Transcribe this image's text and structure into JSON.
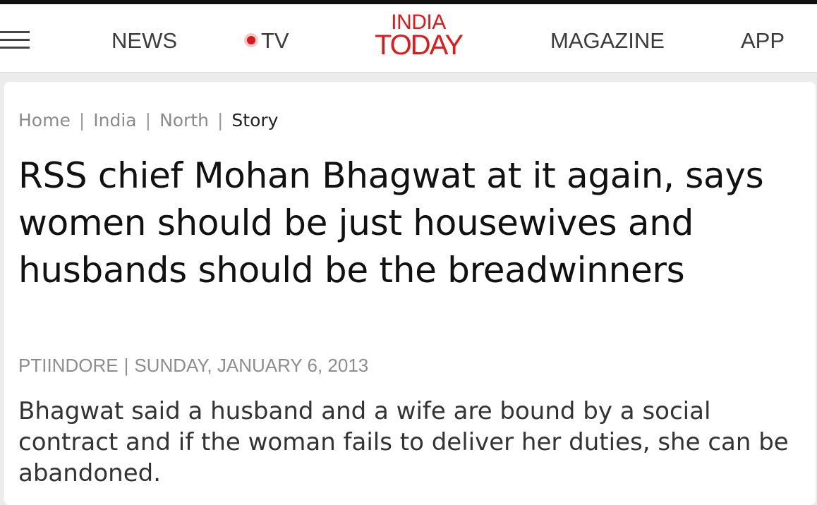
{
  "header": {
    "nav": {
      "news": "NEWS",
      "tv": "TV",
      "magazine": "MAGAZINE",
      "app": "APP"
    },
    "logo": {
      "line1": "INDIA",
      "line2": "TODAY"
    },
    "icons": {
      "menu": "hamburger-menu-icon",
      "live": "live-dot-icon"
    },
    "colors": {
      "brand_red": "#e0191b",
      "live_dot": "#d7191c"
    }
  },
  "breadcrumb": {
    "home": "Home",
    "separator": "|",
    "india": "India",
    "north": "North",
    "current": "Story"
  },
  "article": {
    "headline": "RSS chief Mohan Bhagwat at it again, says women should be just housewives and husbands should be the breadwinners",
    "byline": {
      "source": "PTIINDORE",
      "separator": "|",
      "date": "SUNDAY, JANUARY 6, 2013"
    },
    "summary": "Bhagwat said a husband and a wife are bound by a social contract and if the woman fails to deliver her duties, she can be abandoned."
  }
}
